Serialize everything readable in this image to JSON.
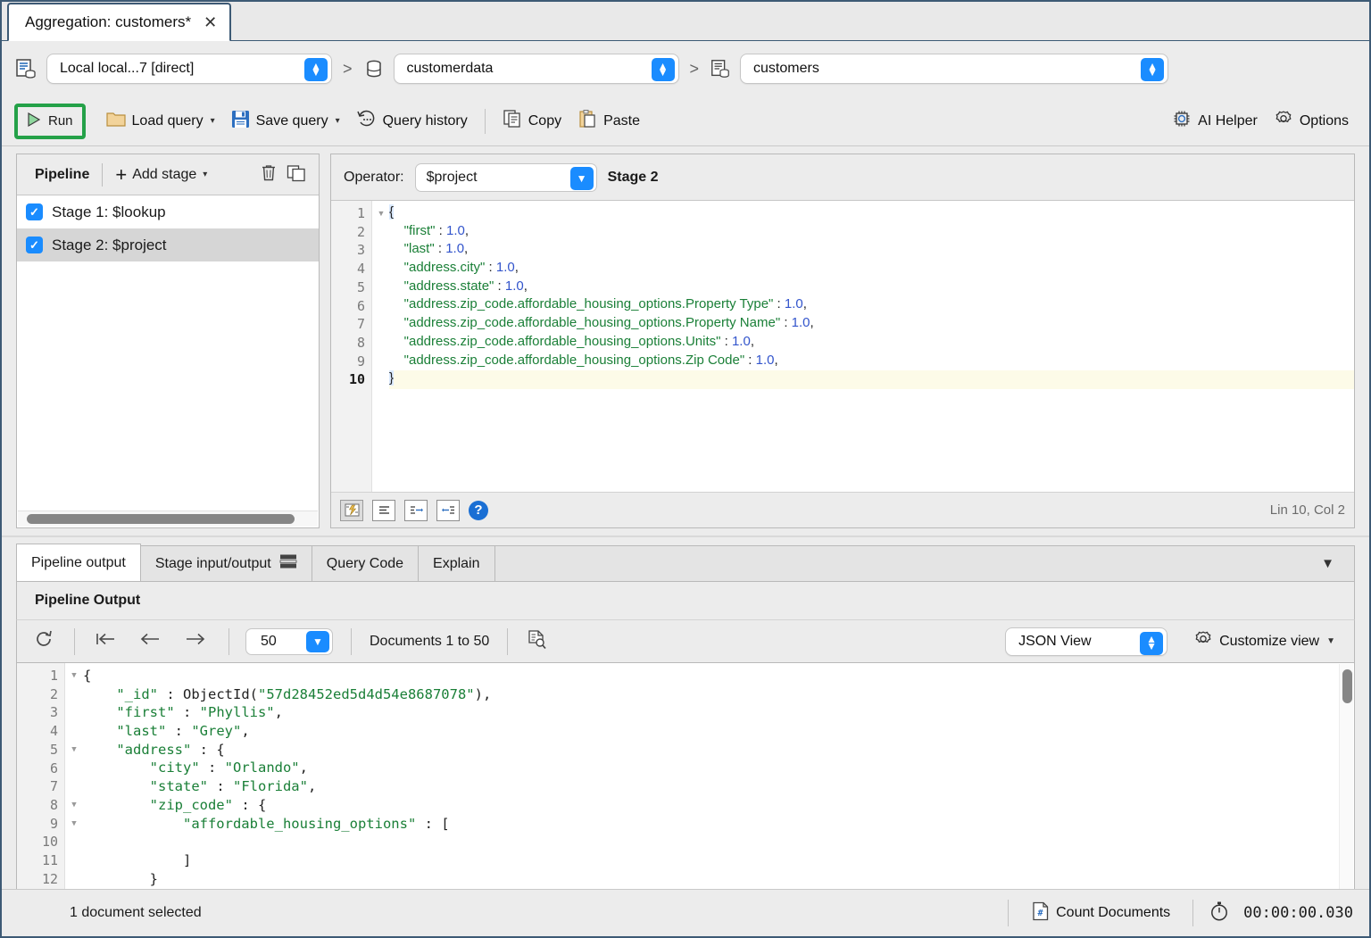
{
  "tab": {
    "title": "Aggregation: customers*",
    "close_icon": "close-icon"
  },
  "connection_bar": {
    "connection": "Local local...7 [direct]",
    "database": "customerdata",
    "collection": "customers",
    "separator": ">"
  },
  "toolbar": {
    "run": "Run",
    "load_query": "Load query",
    "save_query": "Save query",
    "query_history": "Query history",
    "copy": "Copy",
    "paste": "Paste",
    "ai_helper": "AI Helper",
    "options": "Options",
    "caret": "▾"
  },
  "pipeline": {
    "title": "Pipeline",
    "add_stage": "Add stage",
    "add_stage_caret": "▾",
    "plus": "+",
    "delete_icon": "trash-icon",
    "duplicate_icon": "copy-stage-icon",
    "stages": [
      {
        "label": "Stage 1: $lookup",
        "checked": true,
        "selected": false
      },
      {
        "label": "Stage 2: $project",
        "checked": true,
        "selected": true
      }
    ],
    "check_glyph": "✓"
  },
  "stage_editor": {
    "operator_label": "Operator:",
    "operator_value": "$project",
    "stage_label": "Stage 2",
    "caret": "⌄",
    "lincol": "Lin 10, Col 2",
    "lines": [
      {
        "n": 1,
        "fold": true,
        "hl": false,
        "text": "{",
        "type": "brace"
      },
      {
        "n": 2,
        "fold": false,
        "hl": false,
        "key": "\"first\"",
        "val": "1.0",
        "indent": 4,
        "comma": true
      },
      {
        "n": 3,
        "fold": false,
        "hl": false,
        "key": "\"last\"",
        "val": "1.0",
        "indent": 4,
        "comma": true
      },
      {
        "n": 4,
        "fold": false,
        "hl": false,
        "key": "\"address.city\"",
        "val": "1.0",
        "indent": 4,
        "comma": true
      },
      {
        "n": 5,
        "fold": false,
        "hl": false,
        "key": "\"address.state\"",
        "val": "1.0",
        "indent": 4,
        "comma": true
      },
      {
        "n": 6,
        "fold": false,
        "hl": false,
        "key": "\"address.zip_code.affordable_housing_options.Property Type\"",
        "val": "1.0",
        "indent": 4,
        "comma": true
      },
      {
        "n": 7,
        "fold": false,
        "hl": false,
        "key": "\"address.zip_code.affordable_housing_options.Property Name\"",
        "val": "1.0",
        "indent": 4,
        "comma": true
      },
      {
        "n": 8,
        "fold": false,
        "hl": false,
        "key": "\"address.zip_code.affordable_housing_options.Units\"",
        "val": "1.0",
        "indent": 4,
        "comma": true
      },
      {
        "n": 9,
        "fold": false,
        "hl": false,
        "key": "\"address.zip_code.affordable_housing_options.Zip Code\"",
        "val": "1.0",
        "indent": 4,
        "comma": true
      },
      {
        "n": 10,
        "fold": false,
        "hl": true,
        "text": "}",
        "type": "brace",
        "current": true
      }
    ],
    "foot_buttons": [
      "format-icon",
      "align-icon",
      "indent-right-icon",
      "indent-left-icon",
      "help-icon"
    ],
    "help_glyph": "?"
  },
  "bottom_tabs": [
    {
      "label": "Pipeline output",
      "active": true,
      "icon": null
    },
    {
      "label": "Stage input/output",
      "active": false,
      "icon": "split-view-icon"
    },
    {
      "label": "Query Code",
      "active": false,
      "icon": null
    },
    {
      "label": "Explain",
      "active": false,
      "icon": null
    }
  ],
  "output": {
    "panel_title": "Pipeline Output",
    "collapse_icon": "chevron-down-icon",
    "refresh_icon": "refresh-icon",
    "first_icon": "go-first-icon",
    "prev_icon": "go-prev-icon",
    "next_icon": "go-next-icon",
    "page_size": "50",
    "page_caret": "⌄",
    "documents_range": "Documents 1 to 50",
    "find_icon": "find-document-icon",
    "view_mode": "JSON View",
    "view_caret": "⌃⌄",
    "customize_view": "Customize view",
    "customize_caret": "▼",
    "lines": [
      {
        "n": 1,
        "fold": true,
        "indent": 0,
        "raw": "{"
      },
      {
        "n": 2,
        "fold": false,
        "indent": 4,
        "key": "\"_id\"",
        "objectid": "57d28452ed5d4d54e8687078",
        "comma": true
      },
      {
        "n": 3,
        "fold": false,
        "indent": 4,
        "key": "\"first\"",
        "str": "\"Phyllis\"",
        "comma": true
      },
      {
        "n": 4,
        "fold": false,
        "indent": 4,
        "key": "\"last\"",
        "str": "\"Grey\"",
        "comma": true
      },
      {
        "n": 5,
        "fold": true,
        "indent": 4,
        "key": "\"address\"",
        "open": "{"
      },
      {
        "n": 6,
        "fold": false,
        "indent": 8,
        "key": "\"city\"",
        "str": "\"Orlando\"",
        "comma": true
      },
      {
        "n": 7,
        "fold": false,
        "indent": 8,
        "key": "\"state\"",
        "str": "\"Florida\"",
        "comma": true
      },
      {
        "n": 8,
        "fold": true,
        "indent": 8,
        "key": "\"zip_code\"",
        "open": "{"
      },
      {
        "n": 9,
        "fold": true,
        "indent": 12,
        "key": "\"affordable_housing_options\"",
        "open": "["
      },
      {
        "n": 10,
        "fold": false,
        "indent": 0,
        "raw": ""
      },
      {
        "n": 11,
        "fold": false,
        "indent": 12,
        "raw": "]"
      },
      {
        "n": 12,
        "fold": false,
        "indent": 8,
        "raw": "}"
      }
    ]
  },
  "status": {
    "selection": "1 document selected",
    "count_documents": "Count Documents",
    "count_icon": "count-documents-icon",
    "timer_icon": "stopwatch-icon",
    "elapsed": "00:00:00.030"
  },
  "colors": {
    "accent_blue": "#1a8cff",
    "run_green": "#24a148",
    "json_key": "#1a7f37",
    "json_number": "#3355cc",
    "window_border": "#3d5a75"
  }
}
